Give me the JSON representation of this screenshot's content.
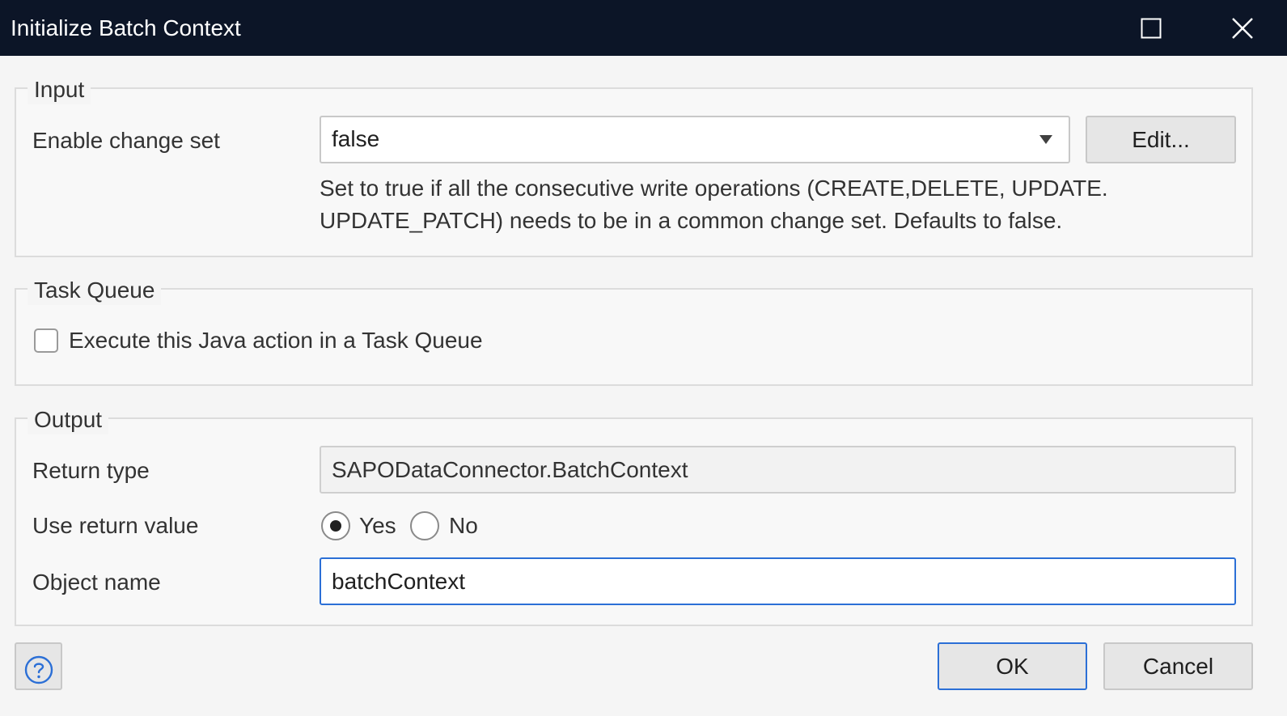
{
  "window": {
    "title": "Initialize Batch Context",
    "maximize_icon": "maximize-icon",
    "close_icon": "close-icon"
  },
  "input_group": {
    "legend": "Input",
    "enable_change_set_label": "Enable change set",
    "enable_change_set_value": "false",
    "edit_button": "Edit...",
    "help_line1": "Set to true if all the consecutive write operations (CREATE,DELETE, UPDATE.",
    "help_line2": "UPDATE_PATCH) needs to be in a common change set. Defaults to false."
  },
  "task_queue_group": {
    "legend": "Task Queue",
    "checkbox_label": "Execute this Java action in a Task Queue",
    "checked": false
  },
  "output_group": {
    "legend": "Output",
    "return_type_label": "Return type",
    "return_type_value": "SAPODataConnector.BatchContext",
    "use_return_value_label": "Use return value",
    "yes_label": "Yes",
    "no_label": "No",
    "selected": "Yes",
    "object_name_label": "Object name",
    "object_name_value": "batchContext"
  },
  "footer": {
    "help_icon": "help-icon",
    "ok_button": "OK",
    "cancel_button": "Cancel"
  },
  "colors": {
    "titlebar": "#0c1527",
    "accent": "#2b6fd6"
  }
}
